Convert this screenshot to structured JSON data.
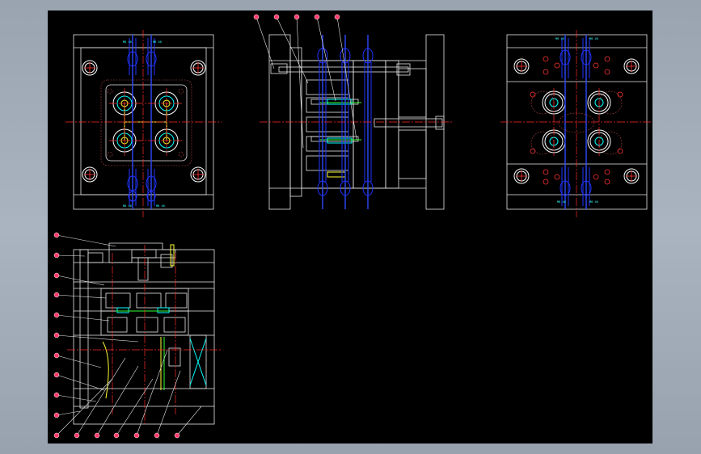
{
  "application": {
    "type": "CAD drawing viewer",
    "background_color": "#a0aab6",
    "canvas_color": "#000000"
  },
  "drawing": {
    "subject": "injection mold assembly drawing",
    "views": [
      {
        "id": "top-left",
        "type": "plan view (fixed half)"
      },
      {
        "id": "top-middle",
        "type": "section view (side)"
      },
      {
        "id": "top-right",
        "type": "plan view (moving half)"
      },
      {
        "id": "bottom-left",
        "type": "section view (front)"
      }
    ],
    "line_colors": {
      "outline": "#e8e8e8",
      "cooling_channels": "#2233ff",
      "center_lines": "#ff2a2a",
      "runner": "#33ff33",
      "sprue": "#ffff33",
      "cavity": "#00ffff",
      "balloon": "#ff3a6a"
    },
    "tiny_labels": {
      "top_left_upper": [
        "M8 40",
        "M8 40"
      ],
      "top_left_lower": [
        "M8 40",
        "M8 40"
      ],
      "top_right_upper": [
        "M8 40",
        "M8 40"
      ],
      "top_right_lower": [
        "M8 40",
        "M8 40"
      ]
    }
  }
}
